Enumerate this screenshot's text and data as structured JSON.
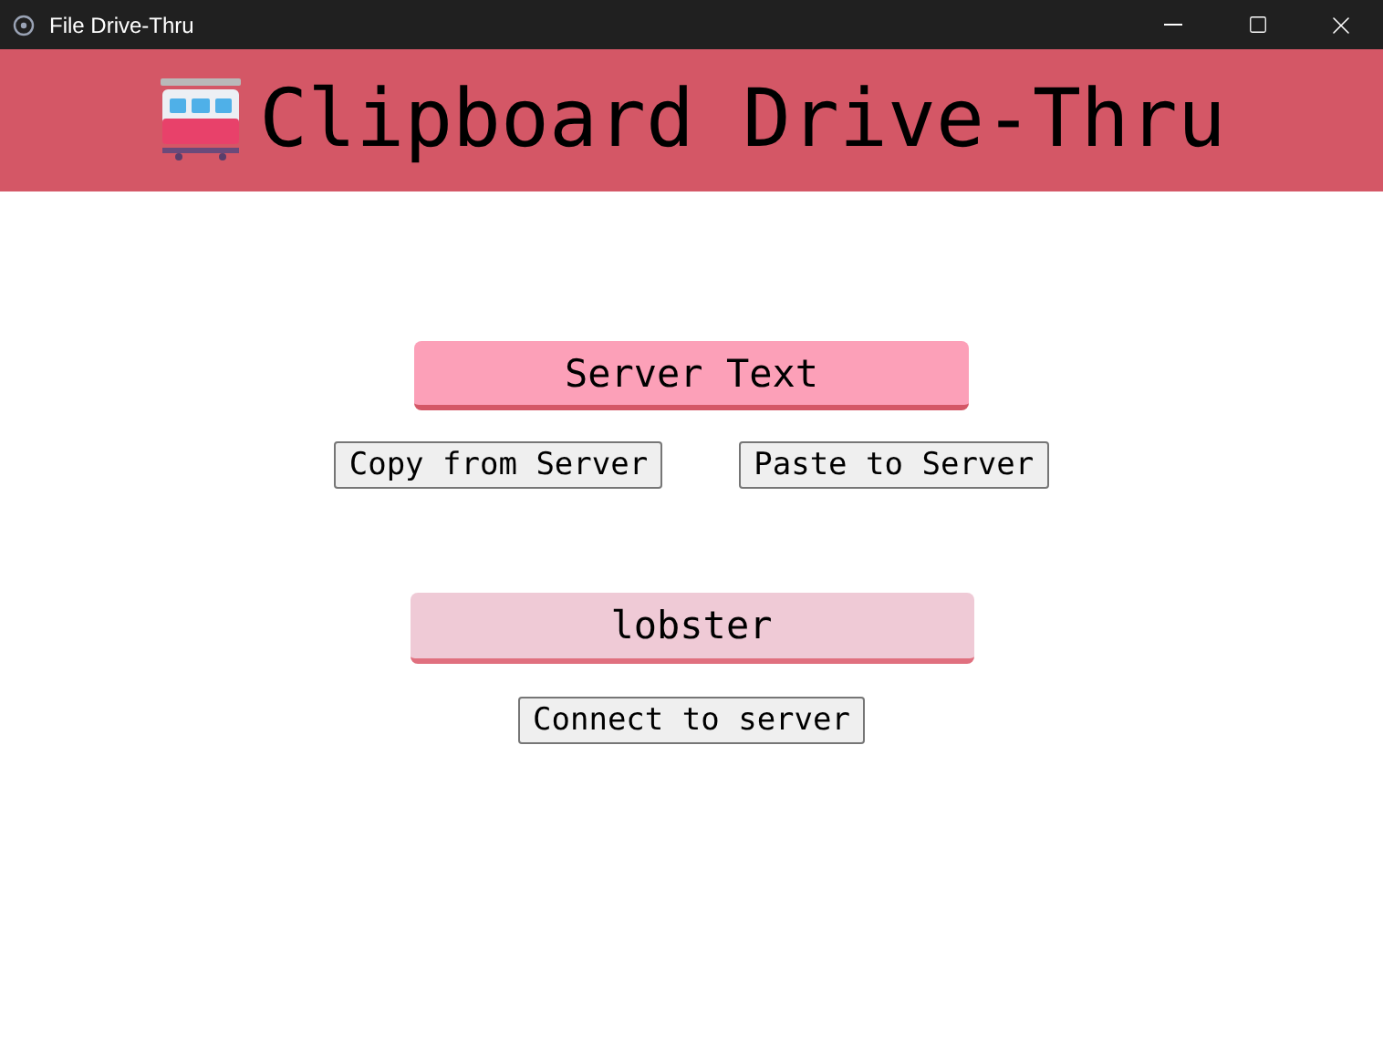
{
  "window": {
    "title": "File Drive-Thru"
  },
  "header": {
    "title": "Clipboard Drive-Thru"
  },
  "server_text_field": {
    "value": "Server Text"
  },
  "clipboard_buttons": [
    "Copy from Server",
    "Paste to Server"
  ],
  "server_name_field": {
    "value": "lobster"
  },
  "connect_button": "Connect to server"
}
